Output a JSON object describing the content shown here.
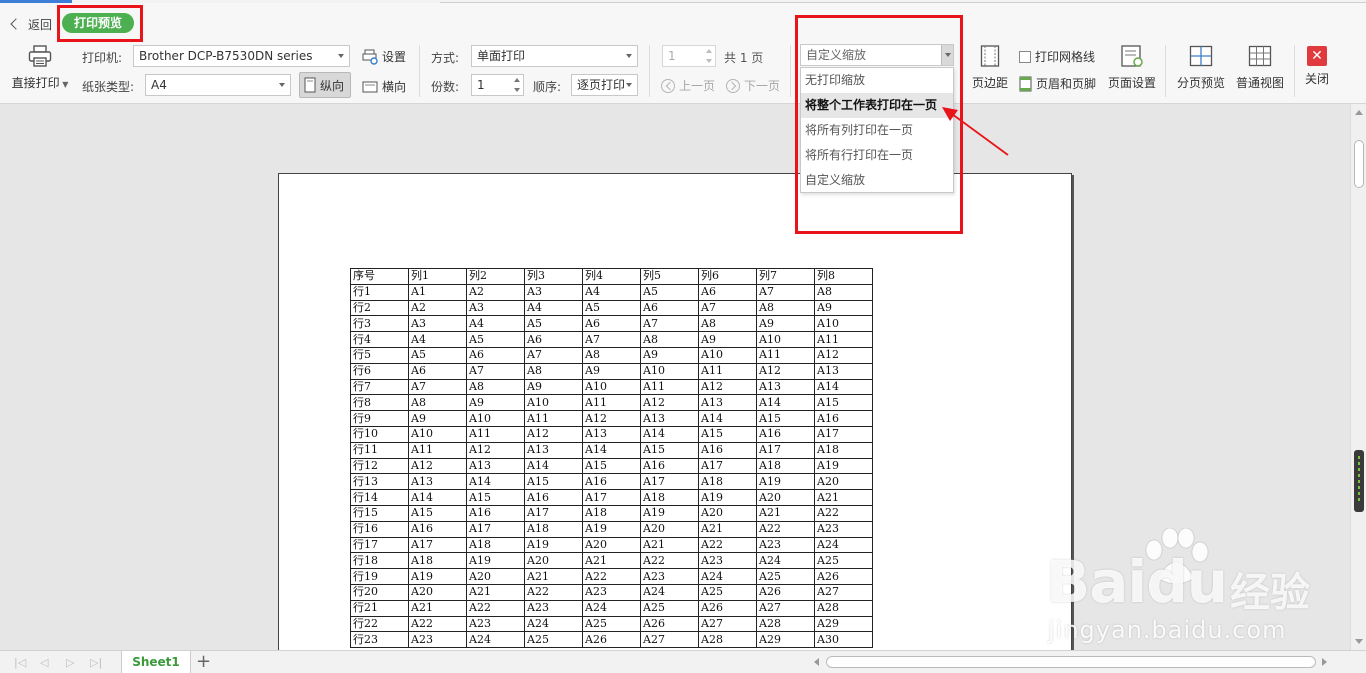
{
  "header": {
    "back_label": "返回",
    "mode_label": "打印预览"
  },
  "print": {
    "direct_print_label": "直接打印"
  },
  "printer": {
    "label": "打印机:",
    "value": "Brother DCP-B7530DN series",
    "settings_label": "设置"
  },
  "paper": {
    "label": "纸张类型:",
    "value": "A4",
    "portrait_label": "纵向",
    "landscape_label": "横向"
  },
  "method": {
    "label": "方式:",
    "value": "单面打印"
  },
  "copies": {
    "label": "份数:",
    "value": "1"
  },
  "order": {
    "label": "顺序:",
    "value": "逐页打印"
  },
  "pager": {
    "current_page": "1",
    "total_label": "共 1 页",
    "prev_label": "上一页",
    "next_label": "下一页"
  },
  "scale": {
    "value": "自定义缩放",
    "options": [
      "无打印缩放",
      "将整个工作表打印在一页",
      "将所有列打印在一页",
      "将所有行打印在一页",
      "自定义缩放"
    ],
    "highlighted_index": 1
  },
  "tools": {
    "margins": "页边距",
    "gridlines": "打印网格线",
    "header_footer": "页眉和页脚",
    "page_setup": "页面设置",
    "page_break_preview": "分页预览",
    "normal_view": "普通视图",
    "close": "关闭"
  },
  "sheet": {
    "headers": [
      "序号",
      "列1",
      "列2",
      "列3",
      "列4",
      "列5",
      "列6",
      "列7",
      "列8"
    ],
    "rows": [
      [
        "行1",
        "A1",
        "A2",
        "A3",
        "A4",
        "A5",
        "A6",
        "A7",
        "A8"
      ],
      [
        "行2",
        "A2",
        "A3",
        "A4",
        "A5",
        "A6",
        "A7",
        "A8",
        "A9"
      ],
      [
        "行3",
        "A3",
        "A4",
        "A5",
        "A6",
        "A7",
        "A8",
        "A9",
        "A10"
      ],
      [
        "行4",
        "A4",
        "A5",
        "A6",
        "A7",
        "A8",
        "A9",
        "A10",
        "A11"
      ],
      [
        "行5",
        "A5",
        "A6",
        "A7",
        "A8",
        "A9",
        "A10",
        "A11",
        "A12"
      ],
      [
        "行6",
        "A6",
        "A7",
        "A8",
        "A9",
        "A10",
        "A11",
        "A12",
        "A13"
      ],
      [
        "行7",
        "A7",
        "A8",
        "A9",
        "A10",
        "A11",
        "A12",
        "A13",
        "A14"
      ],
      [
        "行8",
        "A8",
        "A9",
        "A10",
        "A11",
        "A12",
        "A13",
        "A14",
        "A15"
      ],
      [
        "行9",
        "A9",
        "A10",
        "A11",
        "A12",
        "A13",
        "A14",
        "A15",
        "A16"
      ],
      [
        "行10",
        "A10",
        "A11",
        "A12",
        "A13",
        "A14",
        "A15",
        "A16",
        "A17"
      ],
      [
        "行11",
        "A11",
        "A12",
        "A13",
        "A14",
        "A15",
        "A16",
        "A17",
        "A18"
      ],
      [
        "行12",
        "A12",
        "A13",
        "A14",
        "A15",
        "A16",
        "A17",
        "A18",
        "A19"
      ],
      [
        "行13",
        "A13",
        "A14",
        "A15",
        "A16",
        "A17",
        "A18",
        "A19",
        "A20"
      ],
      [
        "行14",
        "A14",
        "A15",
        "A16",
        "A17",
        "A18",
        "A19",
        "A20",
        "A21"
      ],
      [
        "行15",
        "A15",
        "A16",
        "A17",
        "A18",
        "A19",
        "A20",
        "A21",
        "A22"
      ],
      [
        "行16",
        "A16",
        "A17",
        "A18",
        "A19",
        "A20",
        "A21",
        "A22",
        "A23"
      ],
      [
        "行17",
        "A17",
        "A18",
        "A19",
        "A20",
        "A21",
        "A22",
        "A23",
        "A24"
      ],
      [
        "行18",
        "A18",
        "A19",
        "A20",
        "A21",
        "A22",
        "A23",
        "A24",
        "A25"
      ],
      [
        "行19",
        "A19",
        "A20",
        "A21",
        "A22",
        "A23",
        "A24",
        "A25",
        "A26"
      ],
      [
        "行20",
        "A20",
        "A21",
        "A22",
        "A23",
        "A24",
        "A25",
        "A26",
        "A27"
      ],
      [
        "行21",
        "A21",
        "A22",
        "A23",
        "A24",
        "A25",
        "A26",
        "A27",
        "A28"
      ],
      [
        "行22",
        "A22",
        "A23",
        "A24",
        "A25",
        "A26",
        "A27",
        "A28",
        "A29"
      ],
      [
        "行23",
        "A23",
        "A24",
        "A25",
        "A26",
        "A27",
        "A28",
        "A29",
        "A30"
      ]
    ]
  },
  "footer": {
    "sheet_tab": "Sheet1",
    "add_sheet": "+"
  },
  "watermark": {
    "brand": "Baidu",
    "brand_cn": "经验",
    "url": "jingyan.baidu.com"
  },
  "colors": {
    "accent_green": "#4caf50",
    "highlight_red": "#e8141a",
    "close_red": "#e0393e"
  }
}
